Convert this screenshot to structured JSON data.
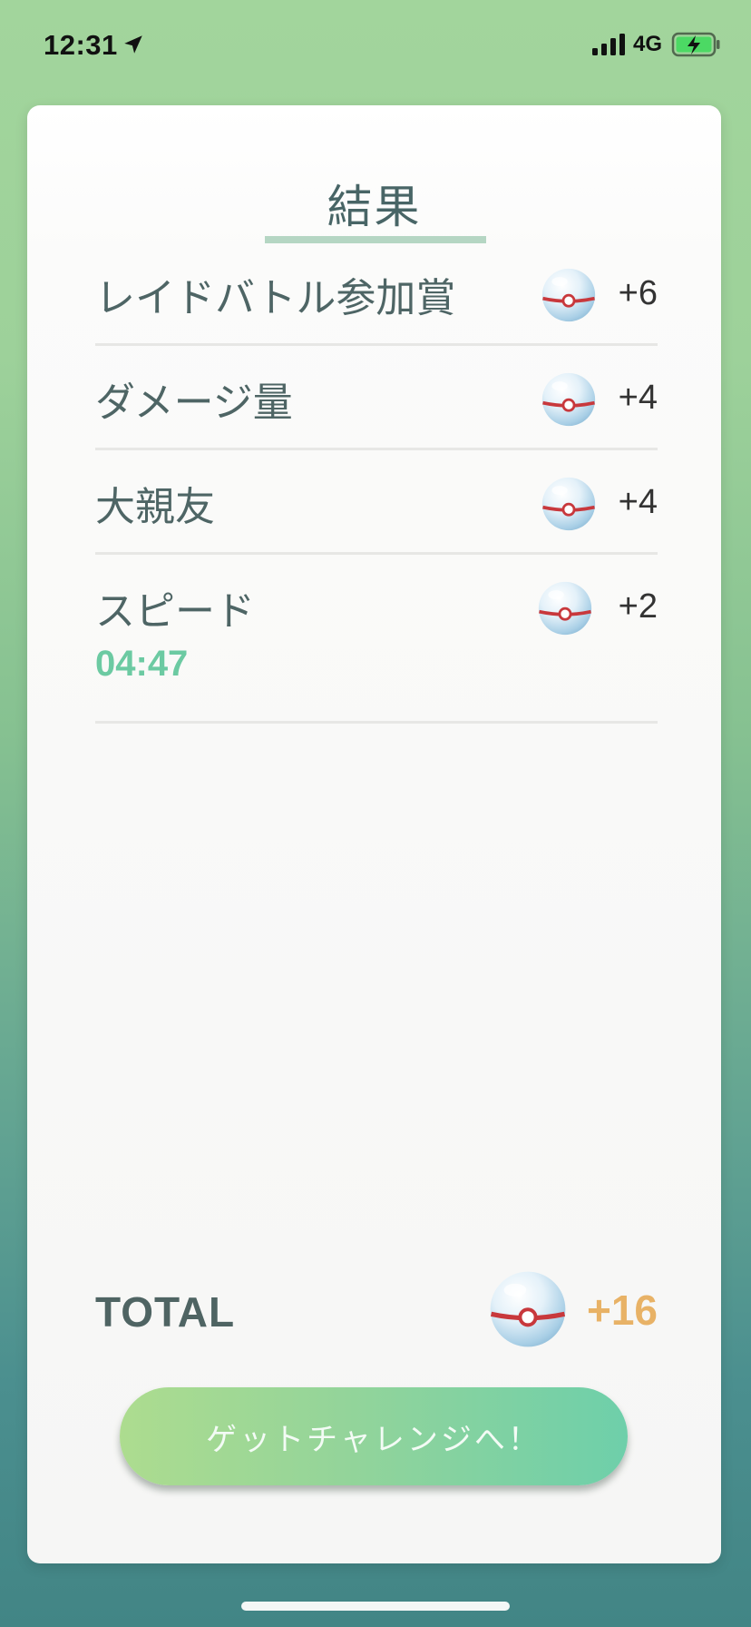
{
  "status_bar": {
    "time": "12:31",
    "network": "4G",
    "icons": [
      "location-arrow-icon",
      "cellular-signal-icon",
      "battery-charging-icon"
    ]
  },
  "card": {
    "title": "結果",
    "rows": [
      {
        "label": "レイドバトル参加賞",
        "count": "+6"
      },
      {
        "label": "ダメージ量",
        "count": "+4"
      },
      {
        "label": "大親友",
        "count": "+4"
      },
      {
        "label": "スピード",
        "count": "+2",
        "sub": "04:47"
      }
    ],
    "total": {
      "label": "TOTAL",
      "count": "+16"
    },
    "button": {
      "label": "ゲットチャレンジへ！"
    }
  },
  "colors": {
    "accent_green": "#6ccaa2",
    "total_orange": "#e8b266",
    "text_slate": "#4e6565",
    "ball_red": "#c8383c"
  }
}
